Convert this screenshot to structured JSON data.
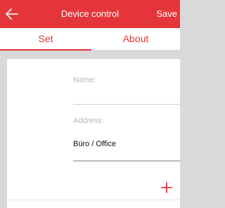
{
  "appbar": {
    "back_icon": "arrow-left-icon",
    "title": "Device control",
    "save_label": "Save",
    "color": "#e4363a"
  },
  "tabs": [
    {
      "label": "Set",
      "active": true
    },
    {
      "label": "About",
      "active": false
    }
  ],
  "form": {
    "name": {
      "label": "Name:",
      "value": ""
    },
    "address": {
      "label": "Address:",
      "value": "Büro / Office"
    }
  },
  "actions": {
    "add_icon": "plus-icon"
  }
}
